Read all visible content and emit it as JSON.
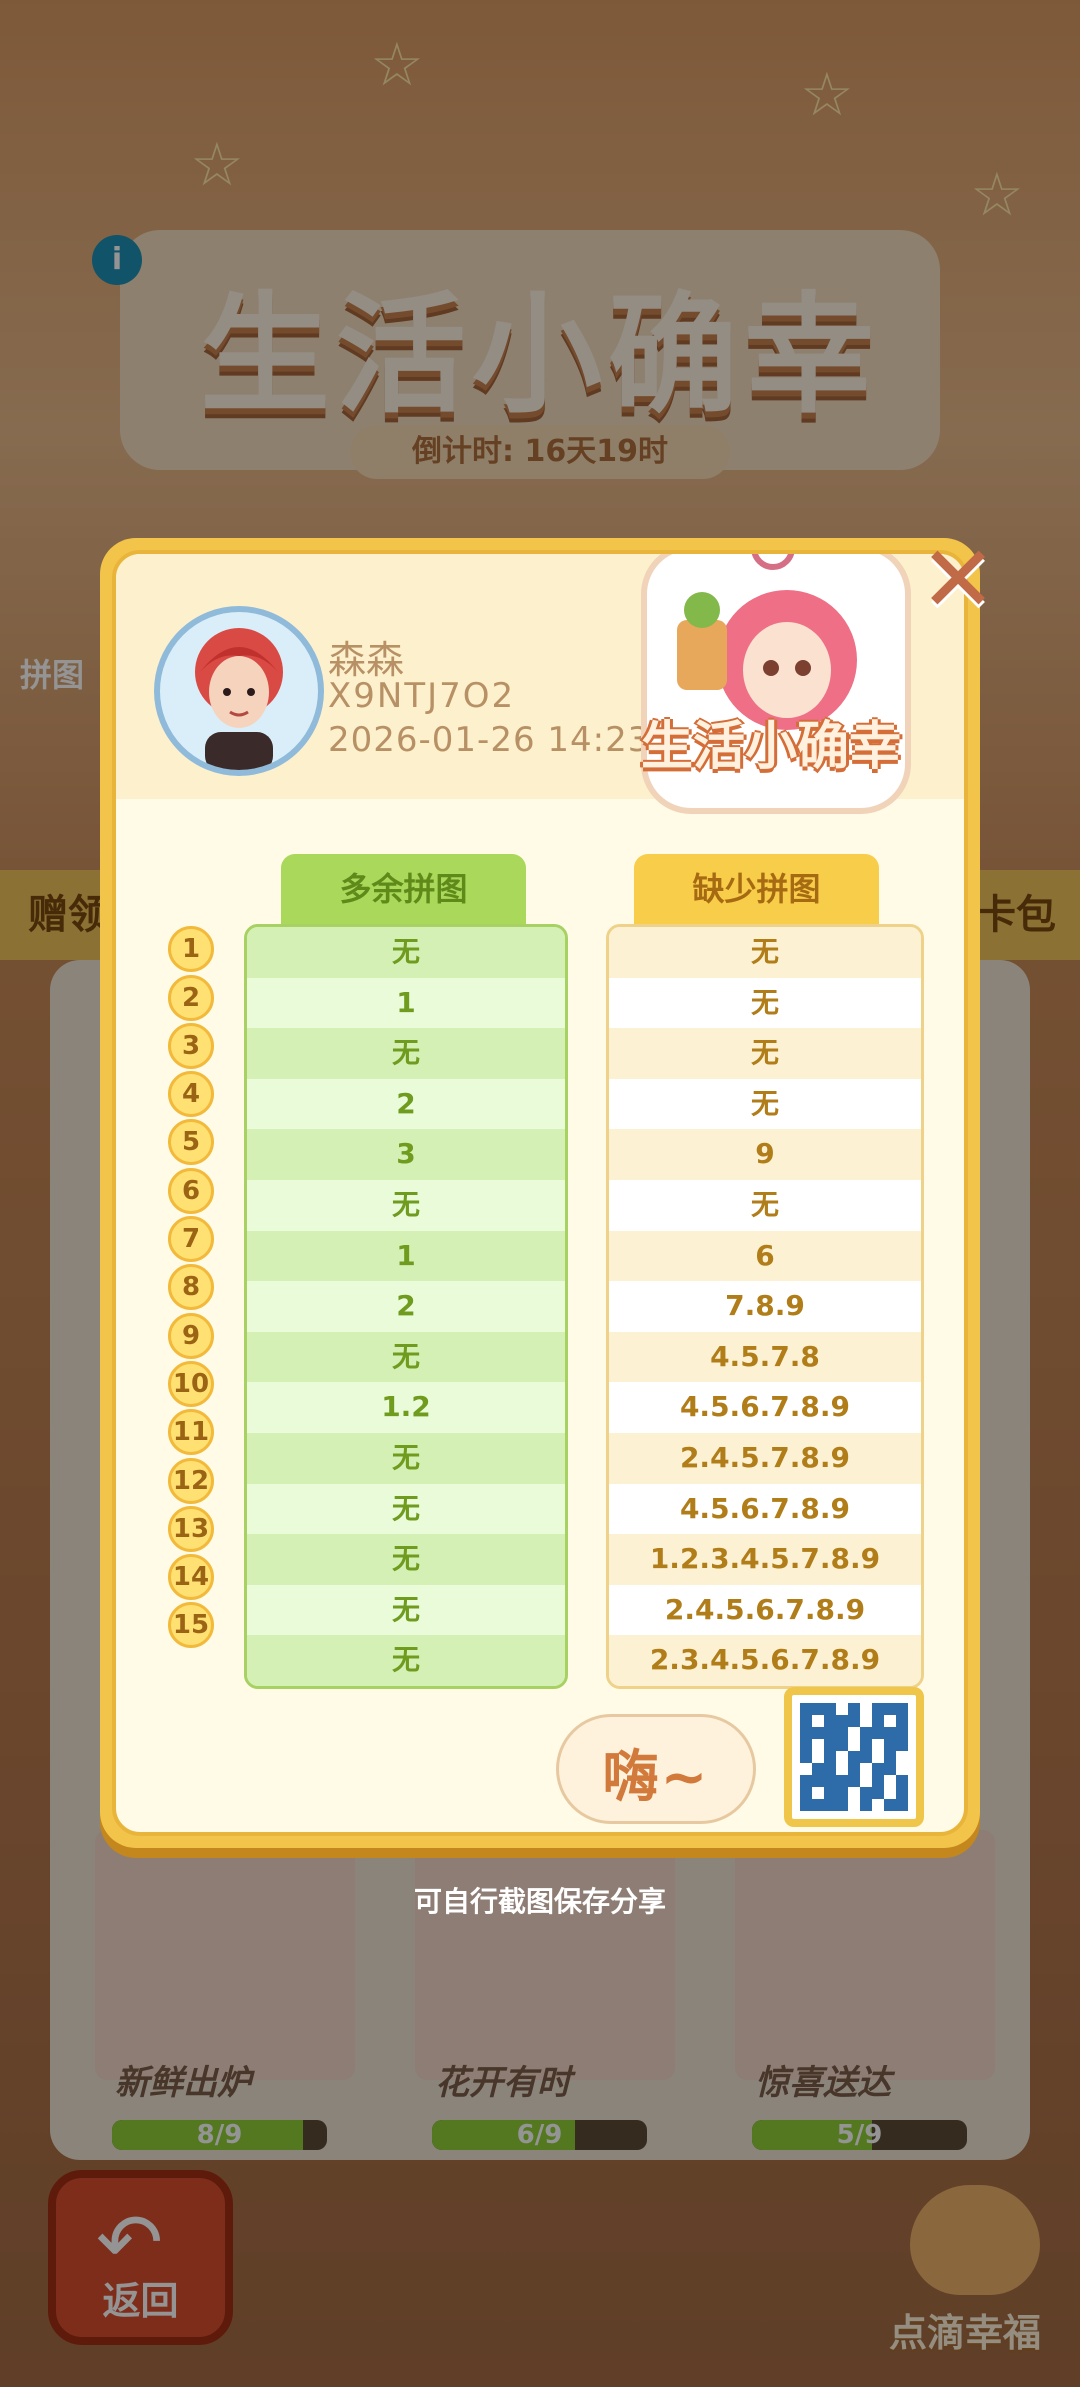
{
  "background": {
    "title": "生活小确幸",
    "countdown": "倒计时: 16天19时",
    "info_icon": "i",
    "left_tab": "赠领",
    "right_tab": "卡包",
    "puzzle_label": "拼图",
    "cards": [
      {
        "caption": "新鲜出炉",
        "progress": "8/9",
        "fraction": 0.889
      },
      {
        "caption": "花开有时",
        "progress": "6/9",
        "fraction": 0.667
      },
      {
        "caption": "惊喜送达",
        "progress": "5/9",
        "fraction": 0.556
      }
    ],
    "back_label": "返回",
    "cat_label": "点滴幸福"
  },
  "modal": {
    "user": {
      "name": "森森",
      "id": "X9NTJ7O2",
      "time": "2026-01-26 14:23"
    },
    "badge_title": "生活小确幸",
    "close_glyph": "✕",
    "extra_header": "多余拼图",
    "missing_header": "缺少拼图",
    "rows": [
      {
        "n": "1",
        "extra": "无",
        "missing": "无"
      },
      {
        "n": "2",
        "extra": "1",
        "missing": "无"
      },
      {
        "n": "3",
        "extra": "无",
        "missing": "无"
      },
      {
        "n": "4",
        "extra": "2",
        "missing": "无"
      },
      {
        "n": "5",
        "extra": "3",
        "missing": "9"
      },
      {
        "n": "6",
        "extra": "无",
        "missing": "无"
      },
      {
        "n": "7",
        "extra": "1",
        "missing": "6"
      },
      {
        "n": "8",
        "extra": "2",
        "missing": "7.8.9"
      },
      {
        "n": "9",
        "extra": "无",
        "missing": "4.5.7.8"
      },
      {
        "n": "10",
        "extra": "1.2",
        "missing": "4.5.6.7.8.9"
      },
      {
        "n": "11",
        "extra": "无",
        "missing": "2.4.5.7.8.9"
      },
      {
        "n": "12",
        "extra": "无",
        "missing": "4.5.6.7.8.9"
      },
      {
        "n": "13",
        "extra": "无",
        "missing": "1.2.3.4.5.7.8.9"
      },
      {
        "n": "14",
        "extra": "无",
        "missing": "2.4.5.6.7.8.9"
      },
      {
        "n": "15",
        "extra": "无",
        "missing": "2.3.4.5.6.7.8.9"
      }
    ],
    "logo_text": "嗨~"
  },
  "hint": "可自行截图保存分享"
}
